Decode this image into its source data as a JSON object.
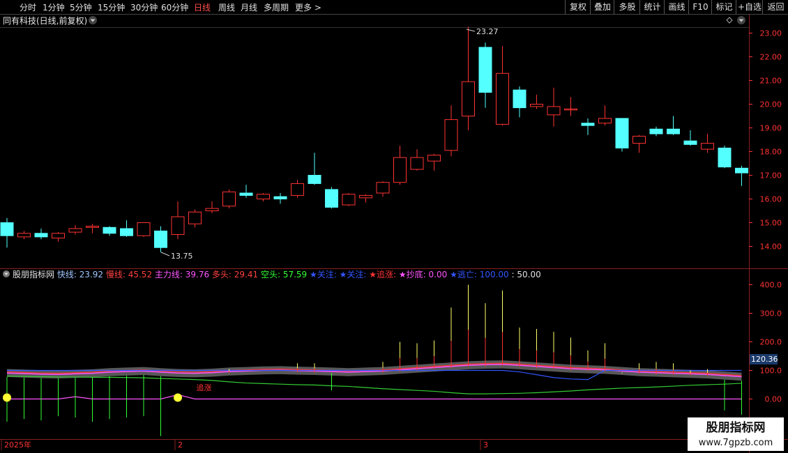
{
  "toolbar": {
    "periods": [
      {
        "label": "分时"
      },
      {
        "label": "1分钟"
      },
      {
        "label": "5分钟"
      },
      {
        "label": "15分钟"
      },
      {
        "label": "30分钟"
      },
      {
        "label": "60分钟"
      },
      {
        "label": "日线",
        "active": true
      },
      {
        "label": "周线"
      },
      {
        "label": "月线"
      },
      {
        "label": "多周期"
      },
      {
        "label": "更多 >"
      }
    ],
    "right_tools": [
      "复权",
      "叠加",
      "多股",
      "统计",
      "画线",
      "F10",
      "标记",
      "+自选",
      "返回"
    ]
  },
  "main_chart": {
    "title": "同有科技(日线,前复权)",
    "price_axis": [
      "23.00",
      "22.00",
      "21.00",
      "20.00",
      "19.00",
      "18.00",
      "17.00",
      "16.00",
      "15.00",
      "14.00"
    ],
    "high_label": "23.27",
    "low_label": "13.75",
    "colors": {
      "up": "#ff3333",
      "down": "#54ffff",
      "axis": "#ff3333",
      "grid": "#8a1f1f"
    }
  },
  "indicator": {
    "name": "股朋指标网",
    "values": [
      {
        "label": "快线",
        "value": "23.92",
        "color": "#9fc5ff"
      },
      {
        "label": "慢线",
        "value": "45.52",
        "color": "#ff4040"
      },
      {
        "label": "主力线",
        "value": "39.76",
        "color": "#ff55ff"
      },
      {
        "label": "多头",
        "value": "29.41",
        "color": "#ff4040"
      },
      {
        "label": "空头",
        "value": "57.59",
        "color": "#33ff33"
      }
    ],
    "markers": [
      {
        "label": "★关注",
        "color": "#3355ff"
      },
      {
        "label": "★关注",
        "color": "#3355ff"
      },
      {
        "label": "★追涨",
        "color": "#ff3333"
      },
      {
        "label": "★抄底",
        "color": "#ff55ff",
        "value": "0.00"
      },
      {
        "label": "★逃亡",
        "color": "#3355ff",
        "value": "100.00"
      }
    ],
    "tail_value": ": 50.00",
    "axis": [
      "400.0",
      "300.0",
      "200.0",
      "100.0",
      "0.00"
    ],
    "current_value": "120.36",
    "chart_label": "追涨"
  },
  "date_axis": [
    "2025年",
    "2",
    "3"
  ],
  "watermark": {
    "text": "股朋指标网",
    "url": "www.7gpzb.com"
  },
  "candles": [
    {
      "o": 15.0,
      "h": 15.2,
      "l": 13.95,
      "c": 14.45
    },
    {
      "o": 14.4,
      "h": 14.65,
      "l": 14.3,
      "c": 14.55
    },
    {
      "o": 14.55,
      "h": 14.75,
      "l": 14.3,
      "c": 14.4
    },
    {
      "o": 14.35,
      "h": 14.6,
      "l": 14.2,
      "c": 14.55
    },
    {
      "o": 14.6,
      "h": 14.9,
      "l": 14.5,
      "c": 14.75
    },
    {
      "o": 14.8,
      "h": 14.95,
      "l": 14.55,
      "c": 14.85
    },
    {
      "o": 14.8,
      "h": 14.85,
      "l": 14.45,
      "c": 14.55
    },
    {
      "o": 14.75,
      "h": 15.1,
      "l": 14.4,
      "c": 14.45
    },
    {
      "o": 14.45,
      "h": 15.0,
      "l": 14.4,
      "c": 15.0
    },
    {
      "o": 14.65,
      "h": 14.85,
      "l": 13.75,
      "c": 13.95
    },
    {
      "o": 14.5,
      "h": 15.9,
      "l": 14.3,
      "c": 15.25
    },
    {
      "o": 14.95,
      "h": 15.55,
      "l": 14.8,
      "c": 15.45
    },
    {
      "o": 15.5,
      "h": 15.9,
      "l": 15.4,
      "c": 15.6
    },
    {
      "o": 15.7,
      "h": 16.4,
      "l": 15.6,
      "c": 16.3
    },
    {
      "o": 16.25,
      "h": 16.6,
      "l": 16.05,
      "c": 16.15
    },
    {
      "o": 16.0,
      "h": 16.25,
      "l": 15.9,
      "c": 16.2
    },
    {
      "o": 16.1,
      "h": 16.25,
      "l": 15.8,
      "c": 16.0
    },
    {
      "o": 16.15,
      "h": 16.8,
      "l": 16.05,
      "c": 16.65
    },
    {
      "o": 17.0,
      "h": 17.95,
      "l": 16.6,
      "c": 16.65
    },
    {
      "o": 16.4,
      "h": 16.5,
      "l": 15.6,
      "c": 15.65
    },
    {
      "o": 15.75,
      "h": 16.25,
      "l": 15.7,
      "c": 16.2
    },
    {
      "o": 16.05,
      "h": 16.2,
      "l": 15.85,
      "c": 16.15
    },
    {
      "o": 16.25,
      "h": 16.75,
      "l": 16.1,
      "c": 16.7
    },
    {
      "o": 16.7,
      "h": 18.25,
      "l": 16.6,
      "c": 17.75
    },
    {
      "o": 17.25,
      "h": 18.1,
      "l": 17.2,
      "c": 17.75
    },
    {
      "o": 17.6,
      "h": 17.9,
      "l": 17.2,
      "c": 17.85
    },
    {
      "o": 18.05,
      "h": 19.95,
      "l": 17.8,
      "c": 19.35
    },
    {
      "o": 19.5,
      "h": 23.27,
      "l": 18.9,
      "c": 20.95
    },
    {
      "o": 22.4,
      "h": 22.6,
      "l": 19.85,
      "c": 20.5
    },
    {
      "o": 19.15,
      "h": 22.45,
      "l": 19.1,
      "c": 21.3
    },
    {
      "o": 20.6,
      "h": 20.75,
      "l": 19.45,
      "c": 19.85
    },
    {
      "o": 19.9,
      "h": 20.4,
      "l": 19.8,
      "c": 20.0
    },
    {
      "o": 19.55,
      "h": 20.7,
      "l": 19.05,
      "c": 19.9
    },
    {
      "o": 19.8,
      "h": 20.3,
      "l": 19.5,
      "c": 19.8
    },
    {
      "o": 19.2,
      "h": 19.4,
      "l": 18.7,
      "c": 19.1
    },
    {
      "o": 19.2,
      "h": 19.95,
      "l": 19.1,
      "c": 19.4
    },
    {
      "o": 19.4,
      "h": 19.4,
      "l": 18.0,
      "c": 18.15
    },
    {
      "o": 18.35,
      "h": 18.7,
      "l": 17.95,
      "c": 18.65
    },
    {
      "o": 18.95,
      "h": 19.05,
      "l": 18.65,
      "c": 18.75
    },
    {
      "o": 18.95,
      "h": 19.5,
      "l": 18.7,
      "c": 18.75
    },
    {
      "o": 18.45,
      "h": 18.9,
      "l": 18.25,
      "c": 18.3
    },
    {
      "o": 18.1,
      "h": 18.75,
      "l": 17.95,
      "c": 18.35
    },
    {
      "o": 18.15,
      "h": 18.25,
      "l": 17.3,
      "c": 17.35
    },
    {
      "o": 17.3,
      "h": 17.4,
      "l": 16.55,
      "c": 17.1
    }
  ]
}
